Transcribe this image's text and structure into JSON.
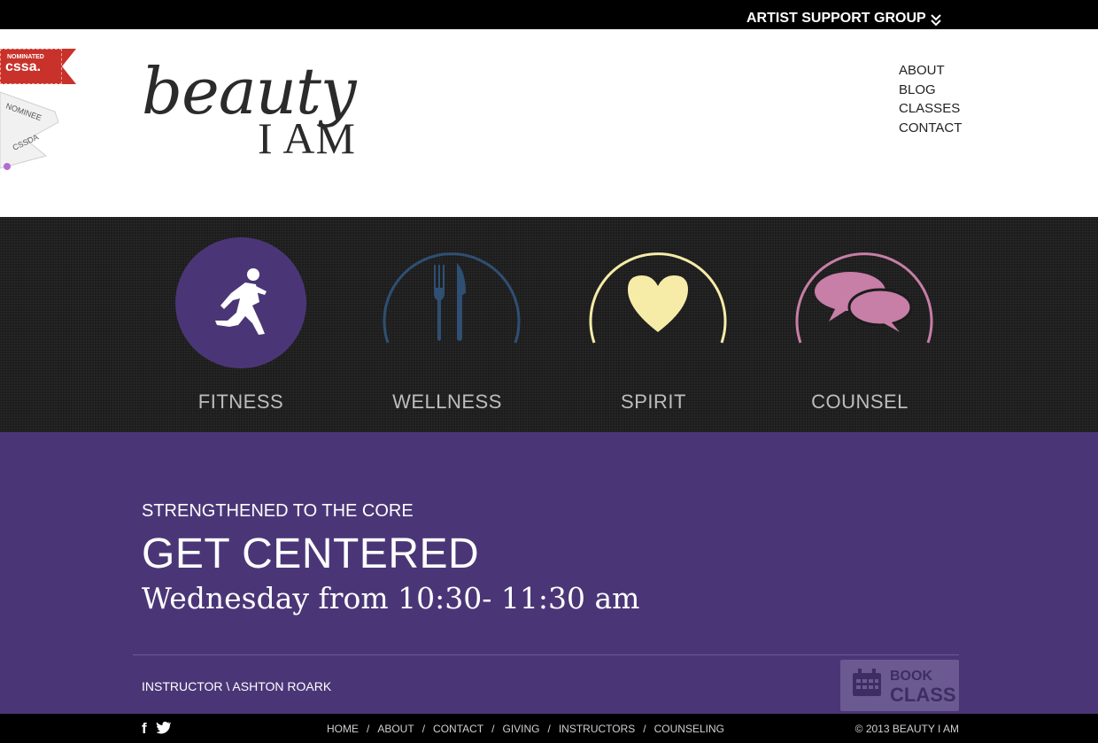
{
  "top_bar": {
    "artist_support_label": "ARTIST SUPPORT GROUP"
  },
  "badges": {
    "cssa_small": "NOMINATED",
    "cssa_big": "cssa.",
    "cssda_line1": "NOMINEE",
    "cssda_line2": "CSSDA"
  },
  "logo": {
    "line1": "beauty",
    "line2": "I AM"
  },
  "nav": [
    "ABOUT",
    "BLOG",
    "CLASSES",
    "CONTACT"
  ],
  "services": [
    {
      "label": "FITNESS",
      "icon": "runner-icon",
      "color": "#4a3677"
    },
    {
      "label": "WELLNESS",
      "icon": "fork-knife-icon",
      "color": "#2f4f73"
    },
    {
      "label": "SPIRIT",
      "icon": "heart-icon",
      "color": "#f6eca8"
    },
    {
      "label": "COUNSEL",
      "icon": "speech-bubbles-icon",
      "color": "#c77ea7"
    }
  ],
  "class_info": {
    "kicker": "STRENGTHENED TO THE CORE",
    "title": "GET CENTERED",
    "schedule": "Wednesday from 10:30- 11:30 am",
    "instructor": "INSTRUCTOR \\ ASHTON ROARK",
    "book_line1": "BOOK",
    "book_line2": "CLASS"
  },
  "footer": {
    "social": [
      "f",
      "t"
    ],
    "links": [
      "HOME",
      "ABOUT",
      "CONTACT",
      "GIVING",
      "INSTRUCTORS",
      "COUNSELING"
    ],
    "separator": "/",
    "copyright": "© 2013 BEAUTY I AM"
  },
  "colors": {
    "brand_purple": "#4a3677",
    "accent_red": "#c8322a",
    "band_dark": "#1c1c1c"
  }
}
